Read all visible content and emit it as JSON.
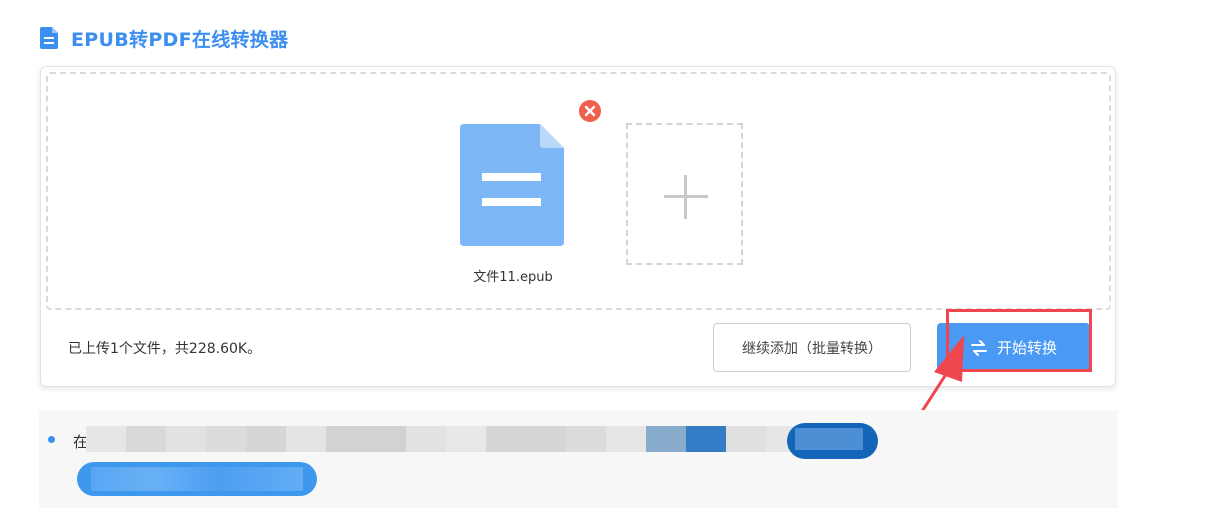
{
  "header": {
    "title": "EPUB转PDF在线转换器",
    "icon": "document-icon",
    "accent_color": "#3d8ef1"
  },
  "uploader": {
    "files": [
      {
        "name": "文件11.epub",
        "icon": "file-icon",
        "remove_icon": "close-circle-icon"
      }
    ],
    "add_tile_icon": "plus-icon",
    "summary": "已上传1个文件，共228.60K。",
    "continue_button_label": "继续添加（批量转换）",
    "start_button_label": "开始转换",
    "start_button_icon": "swap-arrows-icon"
  },
  "info": {
    "bullet_text": "在"
  }
}
